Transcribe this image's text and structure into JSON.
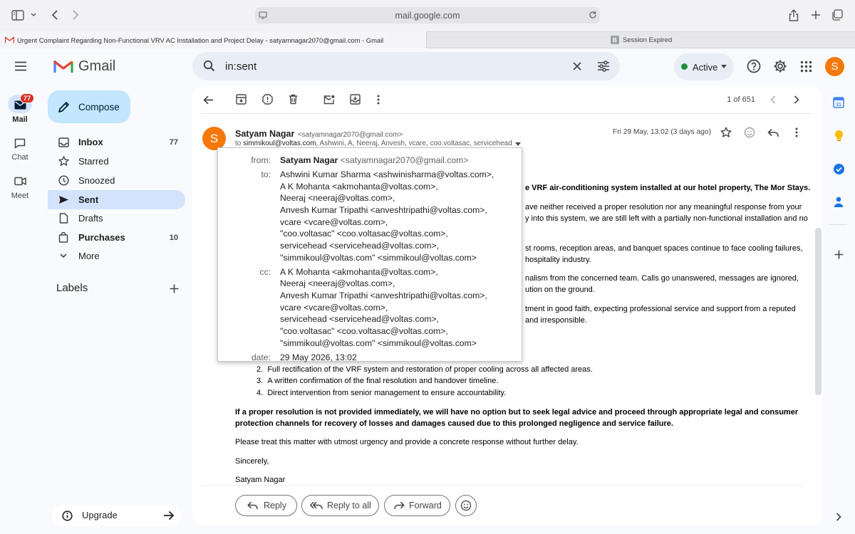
{
  "browser": {
    "url": "mail.google.com",
    "tabs": [
      {
        "label": "Urgent Complaint Regarding Non-Functional VRV AC Installation and Project Delay - satyamnagar2070@gmail.com - Gmail"
      },
      {
        "label": "Session Expired"
      }
    ]
  },
  "gmail": {
    "logo_text": "Gmail",
    "search_query": "in:sent",
    "status": "Active",
    "avatar_letter": "S"
  },
  "rail": {
    "mail_label": "Mail",
    "mail_badge": "77",
    "chat_label": "Chat",
    "meet_label": "Meet"
  },
  "sidebar": {
    "compose": "Compose",
    "items": [
      {
        "label": "Inbox",
        "count": "77"
      },
      {
        "label": "Starred",
        "count": ""
      },
      {
        "label": "Snoozed",
        "count": ""
      },
      {
        "label": "Sent",
        "count": ""
      },
      {
        "label": "Drafts",
        "count": ""
      },
      {
        "label": "Purchases",
        "count": "10"
      },
      {
        "label": "More",
        "count": ""
      }
    ],
    "labels_heading": "Labels",
    "upgrade": "Upgrade"
  },
  "toolbar": {
    "pager": "1 of 651"
  },
  "email": {
    "sender_initial": "S",
    "sender_name": "Satyam Nagar",
    "sender_email": "<satyamnagar2070@gmail.com>",
    "to_prefix": "to",
    "to_first": "simmikoul@voltas.com",
    "to_rest": ", Ashwini, A, Neeraj, Anvesh, vcare, coo.voltasac, servicehead",
    "date": "Fri 29 May, 13:02 (3 days ago)",
    "body": {
      "p1_visible": "e VRF air-conditioning system installed at our hotel property, The Mor Stays.",
      "p2_l1": "ave neither received a proper resolution nor any meaningful response from your",
      "p2_l2": "y into this system, we are still left with a partially non-functional installation and no",
      "p3_l1": "st rooms, reception areas, and banquet spaces continue to face cooling failures,",
      "p3_l2": "hospitality industry.",
      "p4_l1": "nalism from the concerned team. Calls go unanswered, messages are ignored,",
      "p4_l2": "ution on the ground.",
      "p5_l1": "tment in good faith, expecting professional service and support from a reputed",
      "p5_l2": "and irresponsible.",
      "list": [
        {
          "n": "2.",
          "text": "Full rectification of the VRF system and restoration of proper cooling across all affected areas."
        },
        {
          "n": "3.",
          "text": "A written confirmation of the final resolution and handover timeline."
        },
        {
          "n": "4.",
          "text": "Direct intervention from senior management to ensure accountability."
        }
      ],
      "warning_l1": "If a proper resolution is not provided immediately, we will have no option but to seek legal advice and proceed through appropriate legal and consumer",
      "warning_l2": "protection channels for recovery of losses and damages caused due to this prolonged negligence and service failure.",
      "request": "Please treat this matter with utmost urgency and provide a concrete response without further delay.",
      "closing": "Sincerely,",
      "signature": "Satyam Nagar"
    }
  },
  "details_popup": {
    "from_label": "from:",
    "from_name": "Satyam Nagar",
    "from_email": "<satyamnagar2070@gmail.com>",
    "to_label": "to:",
    "to": [
      "Ashwini Kumar Sharma <ashwinisharma@voltas.com>,",
      "A K Mohanta <akmohanta@voltas.com>,",
      "Neeraj <neeraj@voltas.com>,",
      "Anvesh Kumar Tripathi <anveshtripathi@voltas.com>,",
      "vcare <vcare@voltas.com>,",
      "\"coo.voltasac\" <coo.voltasac@voltas.com>,",
      "servicehead <servicehead@voltas.com>,",
      "\"simmikoul@voltas.com\" <simmikoul@voltas.com>"
    ],
    "cc_label": "cc:",
    "cc": [
      "A K Mohanta <akmohanta@voltas.com>,",
      "Neeraj <neeraj@voltas.com>,",
      "Anvesh Kumar Tripathi <anveshtripathi@voltas.com>,",
      "vcare <vcare@voltas.com>,",
      "servicehead <servicehead@voltas.com>,",
      "\"coo.voltasac\" <coo.voltasac@voltas.com>,",
      "\"simmikoul@voltas.com\" <simmikoul@voltas.com>"
    ],
    "date_label": "date:",
    "date_value": "29 May 2026, 13:02"
  },
  "actions": {
    "reply": "Reply",
    "reply_all": "Reply to all",
    "forward": "Forward"
  },
  "colors": {
    "accent_blue": "#0b57d0",
    "compose_bg": "#c2e7ff",
    "selected_nav": "#d3e3fd",
    "avatar_orange": "#f4780a",
    "badge_red": "#d93025",
    "active_green": "#1e8e3e"
  }
}
